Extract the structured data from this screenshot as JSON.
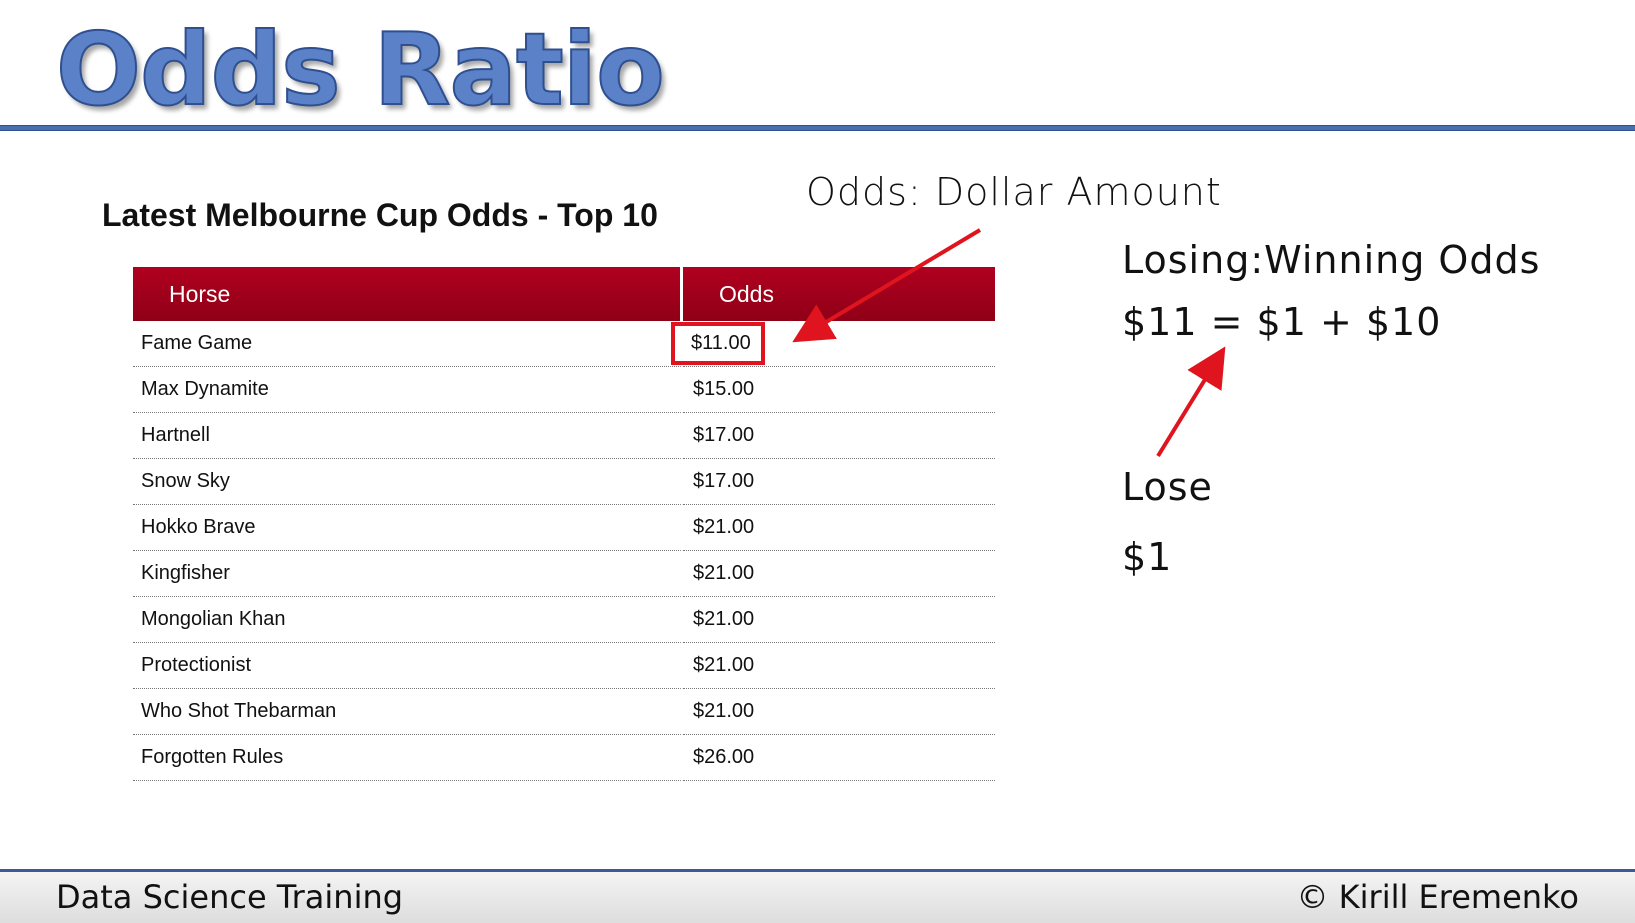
{
  "slide": {
    "title": "Odds Ratio"
  },
  "table": {
    "heading": "Latest Melbourne Cup Odds - Top 10",
    "columns": [
      "Horse",
      "Odds"
    ],
    "rows": [
      {
        "horse": "Fame Game",
        "odds": "$11.00"
      },
      {
        "horse": "Max Dynamite",
        "odds": "$15.00"
      },
      {
        "horse": "Hartnell",
        "odds": "$17.00"
      },
      {
        "horse": "Snow Sky",
        "odds": "$17.00"
      },
      {
        "horse": "Hokko Brave",
        "odds": "$21.00"
      },
      {
        "horse": "Kingfisher",
        "odds": "$21.00"
      },
      {
        "horse": "Mongolian Khan",
        "odds": "$21.00"
      },
      {
        "horse": "Protectionist",
        "odds": "$21.00"
      },
      {
        "horse": "Who Shot Thebarman",
        "odds": "$21.00"
      },
      {
        "horse": "Forgotten Rules",
        "odds": "$26.00"
      }
    ],
    "highlighted_row": 0,
    "header_color": "#a0001a"
  },
  "annotations": {
    "odds_label": "Odds: Dollar Amount",
    "losing_winning": "Losing:Winning Odds",
    "equation": "$11 = $1 + $10",
    "lose_label": "Lose",
    "lose_value": "$1",
    "arrow_color": "#e0141e"
  },
  "footer": {
    "left": "Data Science Training",
    "right": "© Kirill Eremenko"
  },
  "colors": {
    "title_blue": "#5b82c8",
    "rule_blue": "#4a6fb0"
  }
}
